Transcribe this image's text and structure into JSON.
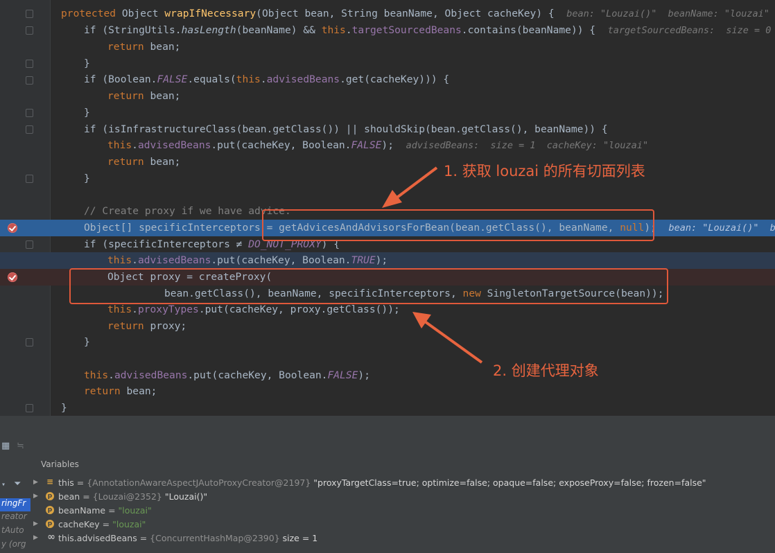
{
  "code": {
    "l1": {
      "kw": "protected",
      "t1": " Object ",
      "fn": "wrapIfNecessary",
      "t2": "(Object bean, String beanName, Object cacheKey) {",
      "hint": "bean: \"Louzai()\"  beanName: \"louzai\""
    },
    "l2": {
      "t1": "if (StringUtils.",
      "st": "hasLength",
      "t2": "(beanName) && ",
      "kw": "this",
      "t3": ".",
      "fld": "targetSourcedBeans",
      "t4": ".contains(beanName)) {",
      "hint": "targetSourcedBeans:  size = 0"
    },
    "l3": {
      "kw": "return",
      "t1": " bean;"
    },
    "l4": {
      "t1": "}"
    },
    "l5": {
      "t1": "if (Boolean.",
      "cst": "FALSE",
      "t2": ".equals(",
      "kw": "this",
      "t3": ".",
      "fld": "advisedBeans",
      "t4": ".get(cacheKey))) {"
    },
    "l6": {
      "kw": "return",
      "t1": " bean;"
    },
    "l7": {
      "t1": "}"
    },
    "l8": {
      "t1": "if (isInfrastructureClass(bean.getClass()) || shouldSkip(bean.getClass(), beanName)) {"
    },
    "l9": {
      "kw": "this",
      "t1": ".",
      "fld": "advisedBeans",
      "t2": ".put(cacheKey, Boolean.",
      "cst": "FALSE",
      "t3": ");",
      "hint": "advisedBeans:  size = 1  cacheKey: \"louzai\""
    },
    "l10": {
      "kw": "return",
      "t1": " bean;"
    },
    "l11": {
      "t1": "}"
    },
    "l12": {
      "cm": "// Create proxy if we have advice."
    },
    "l13": {
      "t1": "Object[] specificInterceptors = getAdvicesAndAdvisorsForBean(bean.getClass(), beanName, ",
      "kw": "null",
      "t2": ");",
      "hint": "bean: \"Louzai()\"  be"
    },
    "l14": {
      "t1": "if (specificInterceptors ≠ ",
      "cst": "DO_NOT_PROXY",
      "t2": ") {"
    },
    "l15": {
      "kw": "this",
      "t1": ".",
      "fld": "advisedBeans",
      "t2": ".put(cacheKey, Boolean.",
      "cst": "TRUE",
      "t3": ");"
    },
    "l16": {
      "t1": "Object proxy = createProxy("
    },
    "l17": {
      "t1": "bean.getClass(), beanName, specificInterceptors, ",
      "kw": "new",
      "t2": " SingletonTargetSource(bean));"
    },
    "l18": {
      "kw": "this",
      "t1": ".",
      "fld": "proxyTypes",
      "t2": ".put(cacheKey, proxy.getClass());"
    },
    "l19": {
      "kw": "return",
      "t1": " proxy;"
    },
    "l20": {
      "t1": "}"
    },
    "l21": {
      "kw": "this",
      "t1": ".",
      "fld": "advisedBeans",
      "t2": ".put(cacheKey, Boolean.",
      "cst": "FALSE",
      "t3": ");"
    },
    "l22": {
      "kw": "return",
      "t1": " bean;"
    },
    "l23": {
      "t1": "}"
    }
  },
  "annotations": {
    "a1": "1. 获取 louzai 的所有切面列表",
    "a2": "2. 创建代理对象",
    "color": "#e8643f"
  },
  "debugger": {
    "panel_title": "Variables",
    "frames": [
      "ringFr",
      "reator",
      "tAuto",
      "y (org"
    ],
    "variables": [
      {
        "name": "this",
        "eq": " = ",
        "type": "{AnnotationAwareAspectJAutoProxyCreator@2197}",
        "value": " \"proxyTargetClass=true; optimize=false; opaque=false; exposeProxy=false; frozen=false\"",
        "icon": "list-icon"
      },
      {
        "name": "bean",
        "eq": " = ",
        "type": "{Louzai@2352}",
        "value": " \"Louzai()\"",
        "icon": "p-icon"
      },
      {
        "name": "beanName",
        "eq": " = ",
        "value": "\"louzai\"",
        "icon": "p-icon"
      },
      {
        "name": "cacheKey",
        "eq": " = ",
        "value": "\"louzai\"",
        "icon": "p-icon"
      },
      {
        "name": "this.advisedBeans",
        "eq": " = ",
        "type": "{ConcurrentHashMap@2390}",
        "value": "  size = 1",
        "icon": "infinity-icon"
      }
    ]
  },
  "colors": {
    "keyword": "#cc7832",
    "field": "#9876aa",
    "method": "#ffc66d",
    "background": "#2b2b2b",
    "exec_line": "#2d6099",
    "annotation": "#e8643f"
  }
}
